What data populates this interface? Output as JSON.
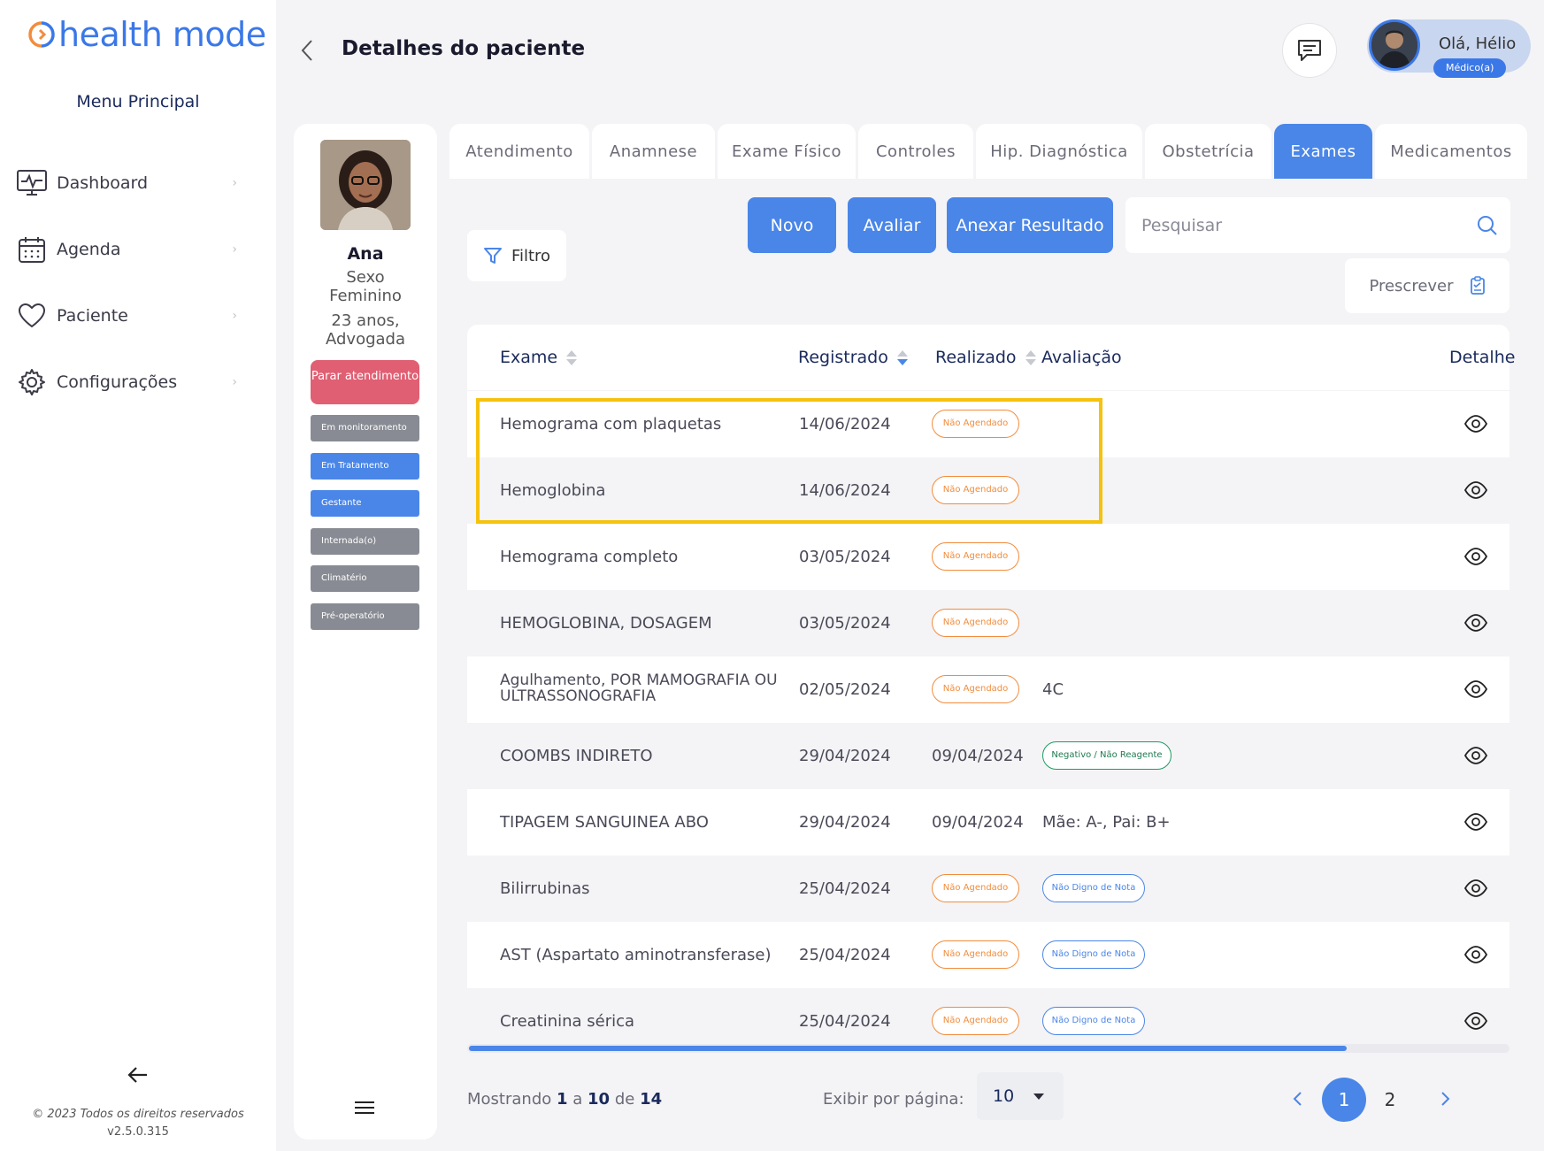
{
  "app": {
    "logo_text": "health mode",
    "menu_title": "Menu Principal",
    "copyright": "© 2023 Todos os direitos reservados",
    "version": "v2.5.0.315",
    "accent_color": "#4a86e8"
  },
  "sidebar": {
    "items": [
      {
        "label": "Dashboard",
        "icon": "monitor-pulse-icon"
      },
      {
        "label": "Agenda",
        "icon": "calendar-icon"
      },
      {
        "label": "Paciente",
        "icon": "heart-icon"
      },
      {
        "label": "Configurações",
        "icon": "gear-icon"
      }
    ]
  },
  "header": {
    "title": "Detalhes do paciente",
    "greeting": "Olá, Hélio",
    "role": "Médico(a)"
  },
  "patient": {
    "name": "Ana",
    "sex_label": "Sexo",
    "sex": "Feminino",
    "age": "23 anos,",
    "occupation": "Advogada",
    "stop_button": "Parar atendimento",
    "tags": [
      "Em monitoramento",
      "Em Tratamento",
      "Gestante",
      "Internada(o)",
      "Climatério",
      "Pré-operatório"
    ]
  },
  "tabs": [
    "Atendimento",
    "Anamnese",
    "Exame Físico",
    "Controles",
    "Hip. Diagnóstica",
    "Obstetrícia",
    "Exames",
    "Medicamentos"
  ],
  "active_tab": "Exames",
  "toolbar": {
    "filter": "Filtro",
    "new": "Novo",
    "evaluate": "Avaliar",
    "attach": "Anexar Resultado",
    "search_placeholder": "Pesquisar",
    "prescribe": "Prescrever"
  },
  "table": {
    "headers": {
      "exam": "Exame",
      "registered": "Registrado",
      "performed": "Realizado",
      "evaluation": "Avaliação",
      "detail": "Detalhe"
    },
    "rows": [
      {
        "exam": "Hemograma com plaquetas",
        "registered": "14/06/2024",
        "performed": "",
        "status": "Não Agendado",
        "evaluation": "",
        "eval_badge": ""
      },
      {
        "exam": "Hemoglobina",
        "registered": "14/06/2024",
        "performed": "",
        "status": "Não Agendado",
        "evaluation": "",
        "eval_badge": ""
      },
      {
        "exam": "Hemograma completo",
        "registered": "03/05/2024",
        "performed": "",
        "status": "Não Agendado",
        "evaluation": "",
        "eval_badge": ""
      },
      {
        "exam": "HEMOGLOBINA, DOSAGEM",
        "registered": "03/05/2024",
        "performed": "",
        "status": "Não Agendado",
        "evaluation": "",
        "eval_badge": ""
      },
      {
        "exam": "Agulhamento, POR MAMOGRAFIA OU ULTRASSONOGRAFIA",
        "registered": "02/05/2024",
        "performed": "",
        "status": "Não Agendado",
        "evaluation": "4C",
        "eval_badge": ""
      },
      {
        "exam": "COOMBS INDIRETO",
        "registered": "29/04/2024",
        "performed": "09/04/2024",
        "status": "",
        "evaluation": "",
        "eval_badge": "Negativo / Não Reagente"
      },
      {
        "exam": "TIPAGEM SANGUINEA ABO",
        "registered": "29/04/2024",
        "performed": "09/04/2024",
        "status": "",
        "evaluation": "Mãe: A-, Pai: B+",
        "eval_badge": ""
      },
      {
        "exam": "Bilirrubinas",
        "registered": "25/04/2024",
        "performed": "",
        "status": "Não Agendado",
        "evaluation": "",
        "eval_badge": "Não Digno de Nota"
      },
      {
        "exam": "AST (Aspartato aminotransferase)",
        "registered": "25/04/2024",
        "performed": "",
        "status": "Não Agendado",
        "evaluation": "",
        "eval_badge": "Não Digno de Nota"
      },
      {
        "exam": "Creatinina sérica",
        "registered": "25/04/2024",
        "performed": "",
        "status": "Não Agendado",
        "evaluation": "",
        "eval_badge": "Não Digno de Nota"
      }
    ]
  },
  "pagination": {
    "showing_prefix": "Mostrando",
    "from": "1",
    "to_word": "a",
    "to": "10",
    "of_word": "de",
    "total": "14",
    "per_page_label": "Exibir por página:",
    "per_page": "10",
    "pages": [
      "1",
      "2"
    ],
    "current_page": "1"
  }
}
